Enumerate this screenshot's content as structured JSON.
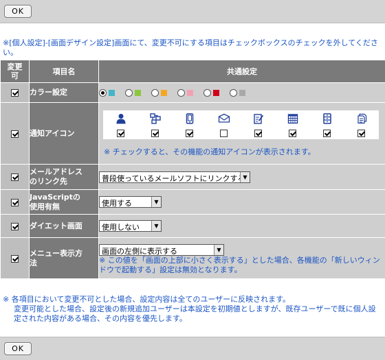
{
  "top": {
    "ok_label": "OK"
  },
  "bottom": {
    "ok_label": "OK"
  },
  "intro": "※[個人設定]-[画面デザイン設定]画面にて、変更不可にする項目はチェックボックスのチェックを外してください。",
  "header": {
    "changeable_line1": "変更",
    "changeable_line2": "可",
    "item_name": "項目名",
    "common": "共通設定"
  },
  "rows": {
    "color": {
      "label": "カラー設定",
      "checked": true,
      "options": [
        {
          "color": "#42b6c8",
          "selected": true
        },
        {
          "color": "#8cc63e",
          "selected": false
        },
        {
          "color": "#f5a623",
          "selected": false
        },
        {
          "color": "#f4a0b4",
          "selected": false
        },
        {
          "color": "#d0021b",
          "selected": false
        },
        {
          "color": "#a8a8a8",
          "selected": false
        }
      ]
    },
    "notify": {
      "label": "通知アイコン",
      "checked": true,
      "icons": [
        {
          "name": "person-icon",
          "checked": true
        },
        {
          "name": "workflow-icon",
          "checked": true
        },
        {
          "name": "phone-memo-icon",
          "checked": true
        },
        {
          "name": "mail-icon",
          "checked": false
        },
        {
          "name": "memo-edit-icon",
          "checked": true
        },
        {
          "name": "calendar-icon",
          "checked": true
        },
        {
          "name": "cabinet-icon",
          "checked": true
        },
        {
          "name": "documents-icon",
          "checked": true
        }
      ],
      "note": "※ チェックすると、その機能の通知アイコンが表示されます。"
    },
    "mail_link": {
      "label_line1": "メールアドレス",
      "label_line2": "のリンク先",
      "checked": true,
      "selected": "普段使っているメールソフトにリンクする"
    },
    "javascript": {
      "label_line1": "JavaScriptの",
      "label_line2": "使用有無",
      "checked": true,
      "selected": "使用する"
    },
    "diet": {
      "label": "ダイエット画面",
      "checked": true,
      "selected": "使用しない"
    },
    "menu": {
      "label_line1": "メニュー表示方",
      "label_line2": "法",
      "checked": true,
      "selected": "画面の左側に表示する",
      "note": "※ この値を「画面の上部に小さく表示する」とした場合、各機能の「新しいウィンドウで起動する」設定は無効となります。"
    }
  },
  "footnote": {
    "line1": "※ 各項目において変更不可とした場合、設定内容は全てのユーザーに反映されます。",
    "line2": "変更可能とした場合、設定後の新規追加ユーザーは本設定を初期値としますが、既存ユーザーで既に個人設定された内容がある場合、その内容を優先します。"
  },
  "colors": {
    "accent_text": "#1a55c4",
    "icon_blue": "#1f3f9a",
    "header_gray": "#7a7a7a"
  }
}
